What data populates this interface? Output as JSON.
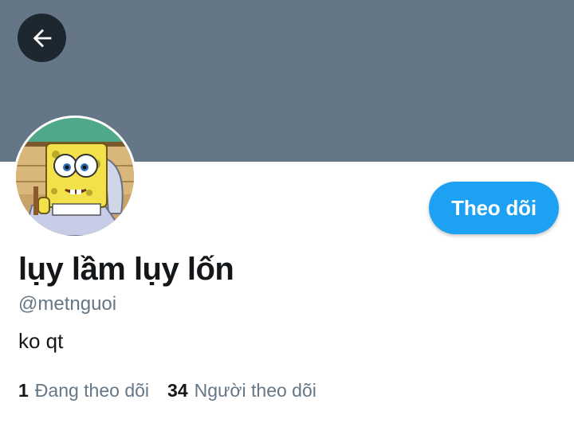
{
  "header": {
    "banner_color": "#657786",
    "back_icon": "arrow-left-icon"
  },
  "profile": {
    "avatar_description": "spongebob-avatar",
    "display_name": "lụy lầm lụy lốn",
    "handle": "@metnguoi",
    "bio": "ko qt",
    "follow_label": "Theo dõi",
    "accent_color": "#1da1f2"
  },
  "stats": {
    "following_count": "1",
    "following_label": "Đang theo dõi",
    "followers_count": "34",
    "followers_label": "Người theo dõi"
  }
}
